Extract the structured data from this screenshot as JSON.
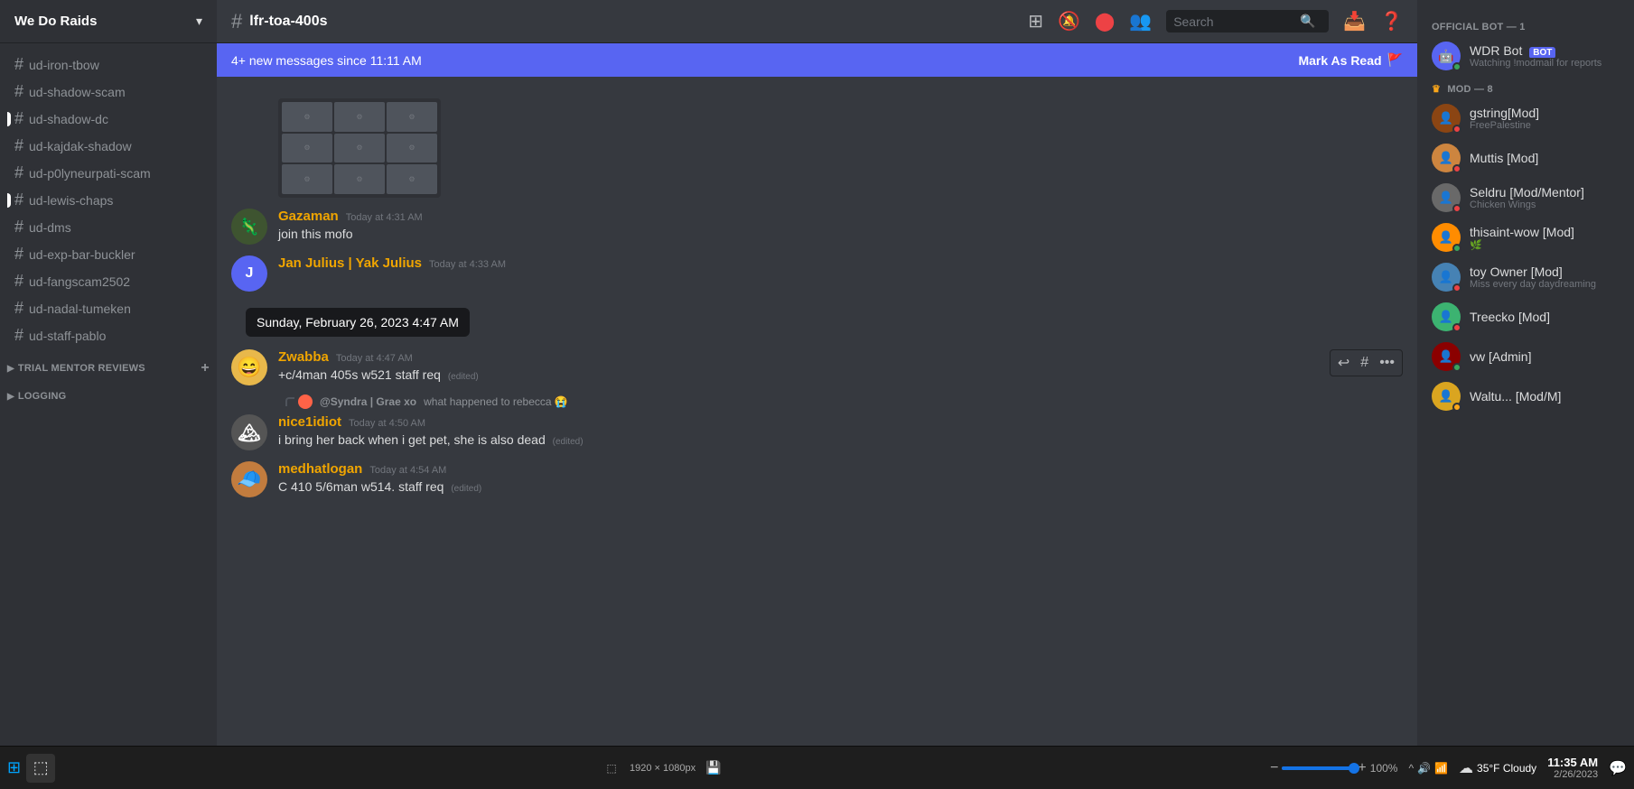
{
  "server": {
    "name": "We Do Raids",
    "chevron": "▾"
  },
  "channels": [
    {
      "name": "ud-iron-tbow",
      "active": false
    },
    {
      "name": "ud-shadow-scam",
      "active": false
    },
    {
      "name": "ud-shadow-dc",
      "active": false,
      "has_dot": true
    },
    {
      "name": "ud-kajdak-shadow",
      "active": false
    },
    {
      "name": "ud-p0lyneurpati-scam",
      "active": false
    },
    {
      "name": "ud-lewis-chaps",
      "active": false,
      "has_dot": true
    },
    {
      "name": "ud-dms",
      "active": false
    },
    {
      "name": "ud-exp-bar-buckler",
      "active": false
    },
    {
      "name": "ud-fangscam2502",
      "active": false
    },
    {
      "name": "ud-nadal-tumeken",
      "active": false
    },
    {
      "name": "ud-staff-pablo",
      "active": false
    }
  ],
  "categories": [
    {
      "name": "TRIAL MENTOR REVIEWS",
      "collapsed": false
    },
    {
      "name": "LOGGING",
      "collapsed": false
    }
  ],
  "current_channel": "lfr-toa-400s",
  "header_icons": {
    "channels_icon": "≡",
    "mute_icon": "🔔",
    "pin_icon": "📌",
    "members_icon": "👥",
    "search_placeholder": "Search",
    "inbox_icon": "📥",
    "help_icon": "?"
  },
  "new_messages_banner": {
    "text": "4+ new messages since 11:11 AM",
    "action": "Mark As Read",
    "flag_icon": "🚩"
  },
  "messages": [
    {
      "id": "msg1",
      "has_attachment": true,
      "attachment_type": "image_grid"
    },
    {
      "id": "msg2",
      "username": "Gazaman",
      "username_color": "#f0a500",
      "timestamp": "Today at 4:31 AM",
      "content": "join this mofo",
      "avatar_color": "#3e5430",
      "avatar_letter": "G"
    },
    {
      "id": "msg3",
      "username": "Jan Julius | Yak Julius",
      "username_color": "#f0a500",
      "timestamp": "Today at 4:33 AM",
      "content": "",
      "avatar_color": "#5865f2",
      "avatar_letter": "J",
      "has_tooltip": true,
      "tooltip_text": "Sunday, February 26, 2023 4:47 AM"
    },
    {
      "id": "msg4",
      "username": "Zwabba",
      "username_color": "#f0a500",
      "timestamp": "Today at 4:47 AM",
      "content": "+c/4man 405s w521 staff req",
      "content_suffix": "(edited)",
      "avatar_color": "#e8b84b",
      "avatar_letter": "Z",
      "show_actions": true
    },
    {
      "id": "msg5",
      "has_reply": true,
      "reply_username": "@Syndra | Grae xo",
      "reply_text": "what happened to rebecca 😭",
      "username": "nice1idiot",
      "username_color": "#f0a500",
      "timestamp": "Today at 4:50 AM",
      "content": "i bring her back when i get pet, she is also dead",
      "content_suffix": "(edited)",
      "avatar_color": "#2f3136",
      "avatar_letter": "N"
    },
    {
      "id": "msg6",
      "username": "medhatlogan",
      "username_color": "#f0a500",
      "timestamp": "Today at 4:54 AM",
      "content": "C 410 5/6man w514. staff req",
      "content_suffix": "(edited)",
      "avatar_color": "#c27c3e",
      "avatar_letter": "M"
    }
  ],
  "members": {
    "bot_category": "OFFICIAL BOT — 1",
    "mod_category": "MOD — 8",
    "bots": [
      {
        "name": "WDR Bot",
        "badge": "BOT",
        "status": "online",
        "activity": "Watching !modmail for reports",
        "avatar_color": "#5865f2",
        "avatar_letter": "W"
      }
    ],
    "mods": [
      {
        "name": "gstring[Mod]",
        "status": "dnd",
        "activity": "FreePalestine",
        "avatar_color": "#8b4513",
        "avatar_letter": "g",
        "has_crown": true
      },
      {
        "name": "Muttis [Mod]",
        "status": "dnd",
        "activity": "",
        "avatar_color": "#cd853f",
        "avatar_letter": "M"
      },
      {
        "name": "Seldru [Mod/Mentor]",
        "status": "dnd",
        "activity": "Chicken Wings",
        "avatar_color": "#696969",
        "avatar_letter": "S"
      },
      {
        "name": "thisaint-wow [Mod]",
        "status": "online",
        "activity": "",
        "avatar_color": "#ff8c00",
        "avatar_letter": "t"
      },
      {
        "name": "toy Owner [Mod]",
        "status": "dnd",
        "activity": "Miss every day daydreaming",
        "avatar_color": "#4682b4",
        "avatar_letter": "t"
      },
      {
        "name": "Treecko [Mod]",
        "status": "dnd",
        "activity": "",
        "avatar_color": "#3cb371",
        "avatar_letter": "T"
      },
      {
        "name": "vw [Admin]",
        "status": "online",
        "activity": "",
        "avatar_color": "#8b0000",
        "avatar_letter": "v"
      },
      {
        "name": "Waltu... [Mod/M]",
        "status": "idle",
        "activity": "",
        "avatar_color": "#daa520",
        "avatar_letter": "W"
      }
    ]
  },
  "taskbar": {
    "zoom_level": "100%",
    "resolution": "1920 × 1080px",
    "weather": "35°F  Cloudy",
    "time": "11:35 AM",
    "date": "2/26/2023"
  }
}
